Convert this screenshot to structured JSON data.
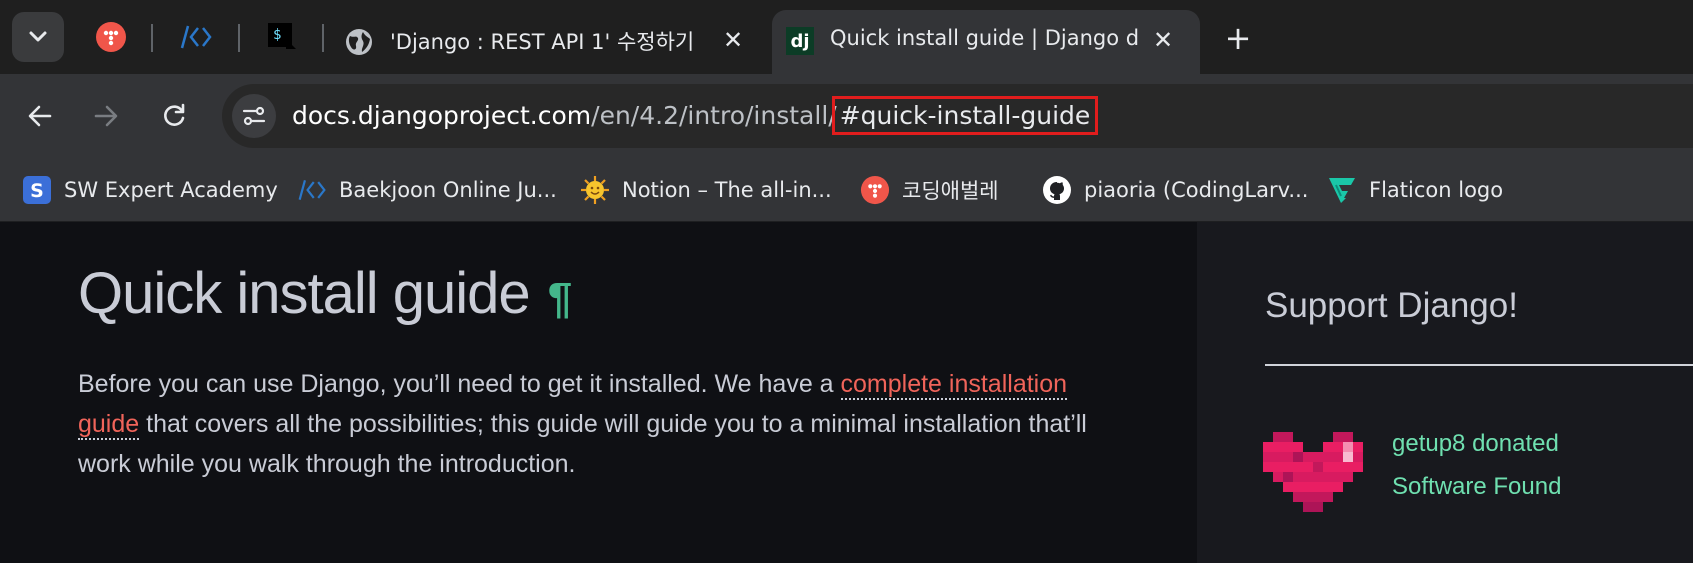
{
  "tabs": {
    "tab_3_title": "'Django : REST API 1' 수정하기",
    "tab_4_title": "Quick install guide | Django documentation",
    "tab_4_favicon_text": "dj",
    "close_symbol": "✕",
    "new_tab_symbol": "+"
  },
  "address_bar": {
    "domain": "docs.djangoproject.com",
    "path": "/en/4.2/intro/install/",
    "fragment": "#quick-install-guide"
  },
  "bookmarks": [
    {
      "label": "SW Expert Academy",
      "icon": "swea-icon"
    },
    {
      "label": "Baekjoon Online Ju...",
      "icon": "baekjoon-icon"
    },
    {
      "label": "Notion – The all-in...",
      "icon": "sun-emoji-icon"
    },
    {
      "label": "코딩애벌레",
      "icon": "codingworm-icon"
    },
    {
      "label": "piaoria (CodingLarv...",
      "icon": "github-icon"
    },
    {
      "label": "Flaticon logo",
      "icon": "flaticon-icon"
    }
  ],
  "article": {
    "heading": "Quick install guide",
    "pilcrow": "¶",
    "intro_before_link": "Before you can use Django, you’ll need to get it installed. We have a ",
    "link_text": "complete installation guide",
    "intro_after_link": " that covers all the possibilities; this guide will guide you to a minimal installation that’ll work while you walk through the introduction."
  },
  "sidebar": {
    "title": "Support Django!",
    "donor_line_1": "getup8 donated",
    "donor_line_2": "Software Found"
  },
  "colors": {
    "accent_green": "#44b78b",
    "link_red": "#f0645a",
    "highlight_box": "#e11d1d"
  }
}
